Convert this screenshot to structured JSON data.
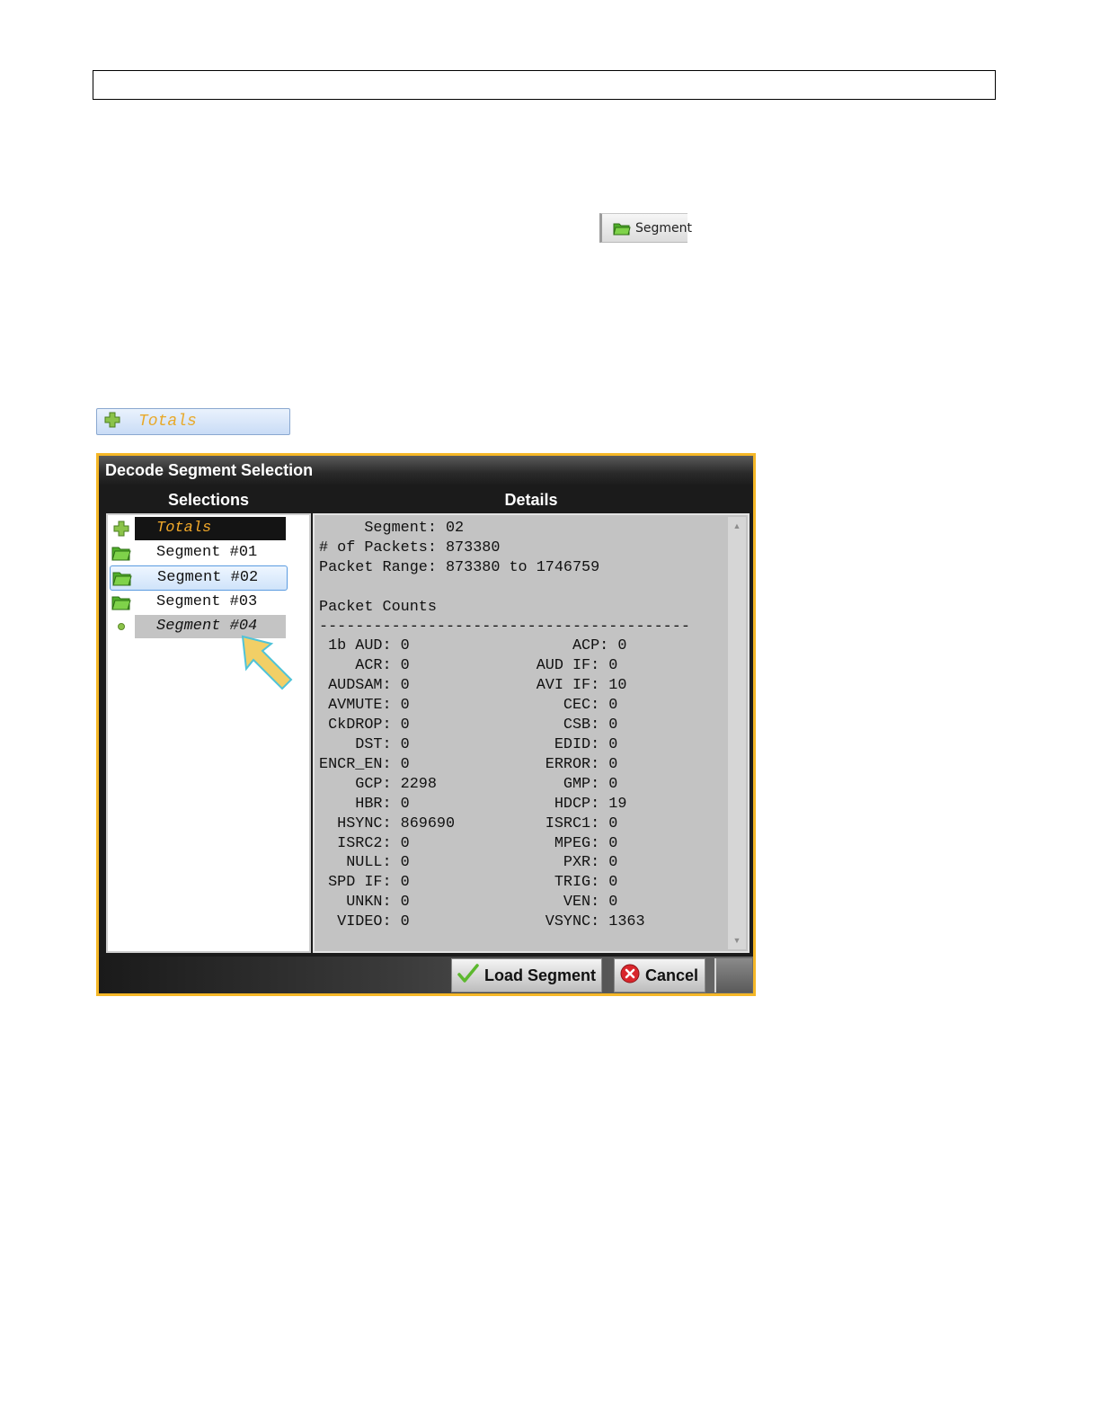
{
  "segment_button": {
    "label": "Segment",
    "icon": "folder-icon"
  },
  "totals_chip": {
    "label": "Totals",
    "icon": "plus-icon"
  },
  "dialog": {
    "title": "Decode Segment Selection",
    "selections_header": "Selections",
    "details_header": "Details",
    "selections": [
      {
        "label": "Totals",
        "icon": "plus-icon",
        "state": "totals"
      },
      {
        "label": "Segment #01",
        "icon": "folder-icon",
        "state": "normal"
      },
      {
        "label": "Segment #02",
        "icon": "folder-icon",
        "state": "selected"
      },
      {
        "label": "Segment #03",
        "icon": "folder-icon",
        "state": "normal"
      },
      {
        "label": "Segment #04",
        "icon": "dot-icon",
        "state": "dim"
      }
    ],
    "details": [
      "     Segment: 02",
      "# of Packets: 873380",
      "Packet Range: 873380 to 1746759",
      "",
      "Packet Counts",
      "-----------------------------------------",
      " 1b AUD: 0                  ACP: 0",
      "    ACR: 0              AUD IF: 0",
      " AUDSAM: 0              AVI IF: 10",
      " AVMUTE: 0                 CEC: 0",
      " CkDROP: 0                 CSB: 0",
      "    DST: 0                EDID: 0",
      "ENCR_EN: 0               ERROR: 0",
      "    GCP: 2298              GMP: 0",
      "    HBR: 0                HDCP: 19",
      "  HSYNC: 869690          ISRC1: 0",
      "  ISRC2: 0                MPEG: 0",
      "   NULL: 0                 PXR: 0",
      " SPD IF: 0                TRIG: 0",
      "   UNKN: 0                 VEN: 0",
      "  VIDEO: 0               VSYNC: 1363"
    ],
    "load_button": "Load Segment",
    "cancel_button": "Cancel"
  },
  "colors": {
    "dialog_border": "#f5b727",
    "totals_text": "#f2a92a",
    "arrow_fill": "#f2cf66",
    "arrow_stroke": "#4fc3d8"
  }
}
